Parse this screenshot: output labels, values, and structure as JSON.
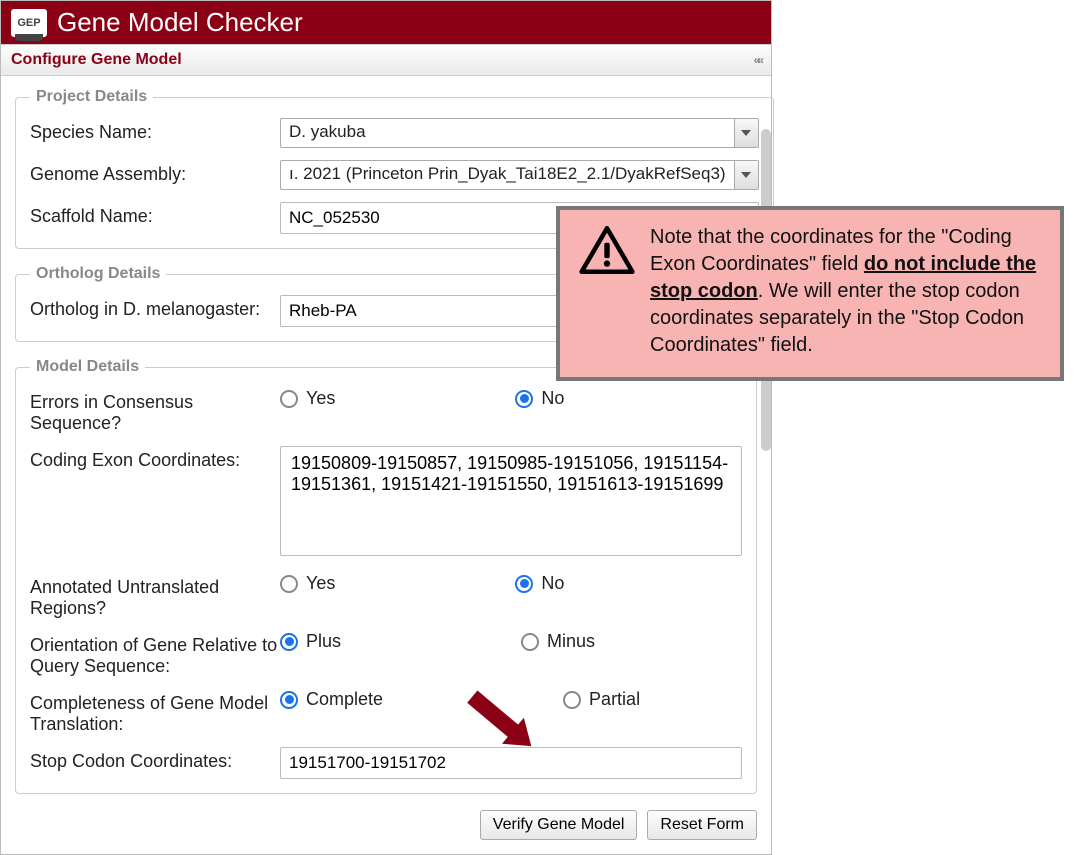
{
  "header": {
    "logo_text": "GEP",
    "app_title": "Gene Model Checker"
  },
  "panel": {
    "title": "Configure Gene Model"
  },
  "project_details": {
    "legend": "Project Details",
    "species_label": "Species Name:",
    "species_value": "D. yakuba",
    "assembly_label": "Genome Assembly:",
    "assembly_value": "ı. 2021 (Princeton Prin_Dyak_Tai18E2_2.1/DyakRefSeq3)",
    "scaffold_label": "Scaffold Name:",
    "scaffold_value": "NC_052530"
  },
  "ortholog_details": {
    "legend": "Ortholog Details",
    "ortholog_label": "Ortholog in D. melanogaster:",
    "ortholog_value": "Rheb-PA"
  },
  "model_details": {
    "legend": "Model Details",
    "errors_label": "Errors in Consensus Sequence?",
    "yes": "Yes",
    "no": "No",
    "coords_label": "Coding Exon Coordinates:",
    "coords_value": "19150809-19150857, 19150985-19151056, 19151154-19151361, 19151421-19151550, 19151613-19151699",
    "utr_label": "Annotated Untranslated Regions?",
    "orientation_label": "Orientation of Gene Relative to Query Sequence:",
    "plus": "Plus",
    "minus": "Minus",
    "completeness_label": "Completeness of Gene Model Translation:",
    "complete": "Complete",
    "partial": "Partial",
    "stop_label": "Stop Codon Coordinates:",
    "stop_value": "19151700-19151702"
  },
  "buttons": {
    "verify": "Verify Gene Model",
    "reset": "Reset Form"
  },
  "callout": {
    "text_pre": "Note that the coordinates for the \"Coding Exon Coordinates\" field ",
    "emph": "do not include the stop codon",
    "text_post": ". We will enter the stop codon coordinates separately in the \"Stop Codon Coordinates\" field."
  }
}
